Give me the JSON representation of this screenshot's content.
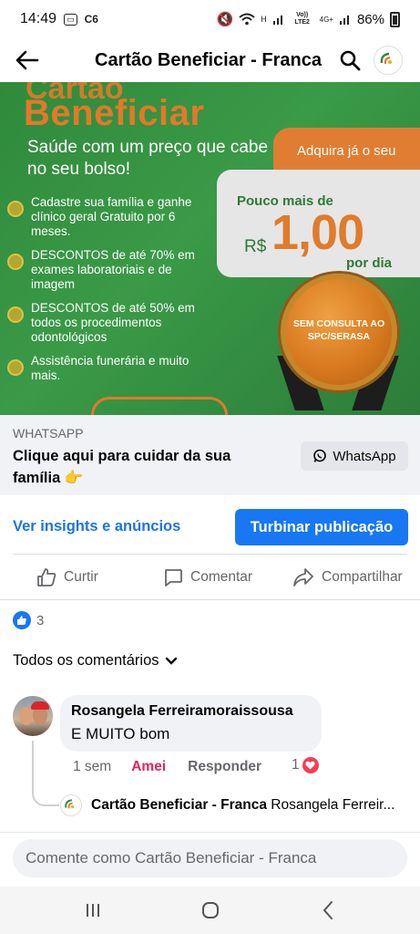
{
  "status_bar": {
    "time": "14:49",
    "left_icons": [
      "sim-card-icon",
      "c6-app-icon"
    ],
    "c6_label": "C6",
    "signal_labels": [
      "H",
      "Vo)) LTE2",
      "4G+"
    ],
    "battery": "86%"
  },
  "header": {
    "title": "Cartão Beneficiar - Franca"
  },
  "banner": {
    "title_top": "Cartão",
    "title": "Beneficiar",
    "subtitle": "Saúde com um preço que cabe no seu bolso!",
    "items": [
      "Cadastre sua família e ganhe clínico geral Gratuito por 6 meses.",
      "DESCONTOS de até 70% em exames laboratoriais e de imagem",
      "DESCONTOS de até 50% em todos os procedimentos odontológicos",
      "Assistência funerária e muito mais."
    ],
    "promo": "Adquira já o seu",
    "price_label": "Pouco mais de",
    "price_currency": "R$",
    "price_value": "1,00",
    "price_period": "por dia",
    "seal_text": "SEM CONSULTA AO SPC/SERASA",
    "colors": {
      "green": "#2f8a3c",
      "orange": "#e07b2a"
    }
  },
  "cta": {
    "source": "WHATSAPP",
    "text": "Clique aqui para cuidar da sua família 👉",
    "button_label": "WhatsApp"
  },
  "insights": {
    "link_label": "Ver insights e anúncios",
    "boost_label": "Turbinar publicação"
  },
  "actions": {
    "like": "Curtir",
    "comment": "Comentar",
    "share": "Compartilhar"
  },
  "reactions": {
    "count": "3"
  },
  "comments_filter": {
    "label": "Todos os comentários"
  },
  "comment": {
    "author": "Rosangela Ferreiramoraissousa",
    "text": "E MUITO bom",
    "time": "1 sem",
    "reaction_label": "Amei",
    "reply_label": "Responder",
    "love_count": "1"
  },
  "reply": {
    "author": "Cartão Beneficiar - Franca",
    "preview": "Rosangela Ferreir..."
  },
  "comment_input": {
    "placeholder": "Comente como Cartão Beneficiar - Franca"
  },
  "colors": {
    "accent_blue": "#1877f2",
    "love_red": "#f33e58",
    "amei_label": "#e0245e"
  }
}
